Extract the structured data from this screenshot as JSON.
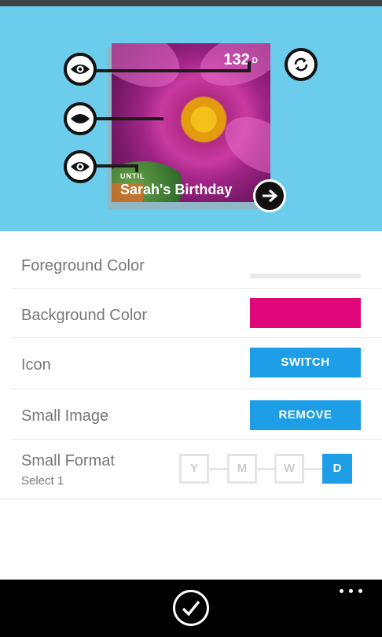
{
  "preview": {
    "count": "132",
    "count_unit": "D",
    "until_label": "UNTIL",
    "event_title": "Sarah's Birthday",
    "background_color": "#6bcdeb"
  },
  "settings": {
    "foreground_color_label": "Foreground Color",
    "background_color_label": "Background Color",
    "background_color_value": "#e0077a",
    "icon_label": "Icon",
    "icon_button": "SWITCH",
    "small_image_label": "Small Image",
    "small_image_button": "REMOVE",
    "small_format_label": "Small Format",
    "small_format_hint": "Select 1",
    "format_options": [
      "Y",
      "M",
      "W",
      "D"
    ],
    "format_selected": "D"
  },
  "icons": {
    "visibility": "eye-icon",
    "hidden": "eye-closed-icon",
    "refresh": "refresh-icon",
    "next": "arrow-right-icon",
    "confirm": "check-icon",
    "more": "more-dots-icon"
  }
}
